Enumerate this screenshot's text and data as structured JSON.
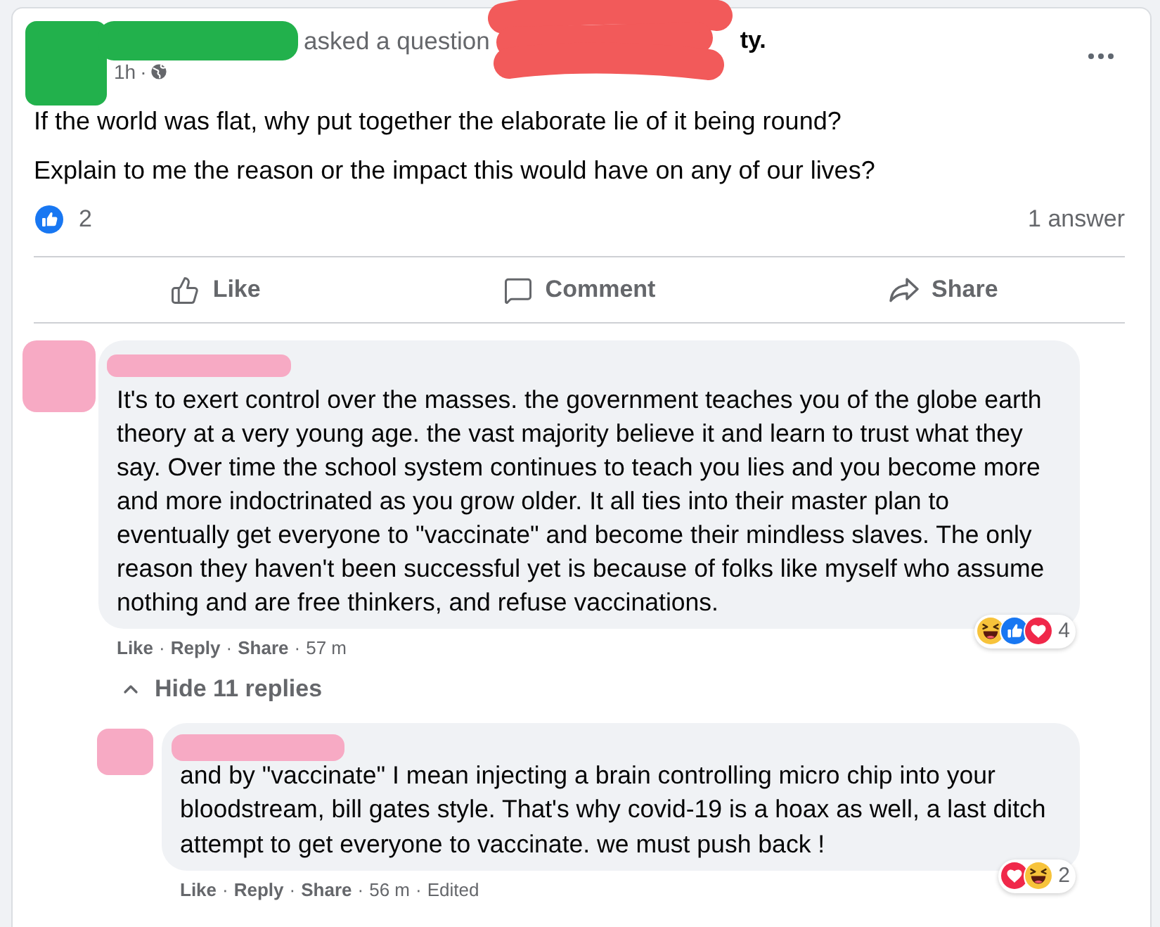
{
  "post": {
    "author_action": "asked a question",
    "group_name_tail": "ty.",
    "time": "1h",
    "separator": "·",
    "paragraphs": [
      "If the world was flat, why put together the elaborate lie of it being round?",
      "Explain to me the reason or the impact this would have on any of our lives?"
    ],
    "like_count": "2",
    "answer_count": "1 answer"
  },
  "actions": [
    {
      "kind": "like",
      "label": "Like"
    },
    {
      "kind": "comment",
      "label": "Comment"
    },
    {
      "kind": "share",
      "label": "Share"
    }
  ],
  "comments": [
    {
      "text": "It's to exert control over the masses. the government teaches you of the globe earth theory at a very young age. the vast majority believe it and learn to trust what they say. Over time the school system continues to teach you lies and you become more and more indoctrinated as you grow older. It all ties into their master plan to eventually get everyone to \"vaccinate\" and become their mindless slaves. The only reason they haven't been successful yet is because of folks like myself who assume nothing and are free thinkers, and refuse vaccinations.",
      "separator": "·",
      "meta": [
        {
          "kind": "link",
          "text": "Like"
        },
        {
          "kind": "link",
          "text": "Reply"
        },
        {
          "kind": "link",
          "text": "Share"
        },
        {
          "kind": "time",
          "text": "57 m"
        }
      ],
      "reactions": {
        "items": [
          {
            "kind": "haha"
          },
          {
            "kind": "like"
          },
          {
            "kind": "love"
          }
        ],
        "count": "4"
      },
      "replies_toggle": {
        "label": "Hide 11 replies",
        "expanded": true
      },
      "replies": [
        {
          "text": "and by \"vaccinate\" I mean injecting a brain controlling micro chip into your bloodstream, bill gates style. That's why covid-19 is a hoax as well, a last ditch attempt to get everyone to vaccinate. we must push back !",
          "separator": "·",
          "meta": [
            {
              "kind": "link",
              "text": "Like"
            },
            {
              "kind": "link",
              "text": "Reply"
            },
            {
              "kind": "link",
              "text": "Share"
            },
            {
              "kind": "time",
              "text": "56 m"
            },
            {
              "kind": "note",
              "text": "Edited"
            }
          ],
          "reactions": {
            "items": [
              {
                "kind": "love"
              },
              {
                "kind": "haha"
              }
            ],
            "count": "2"
          }
        }
      ]
    }
  ]
}
